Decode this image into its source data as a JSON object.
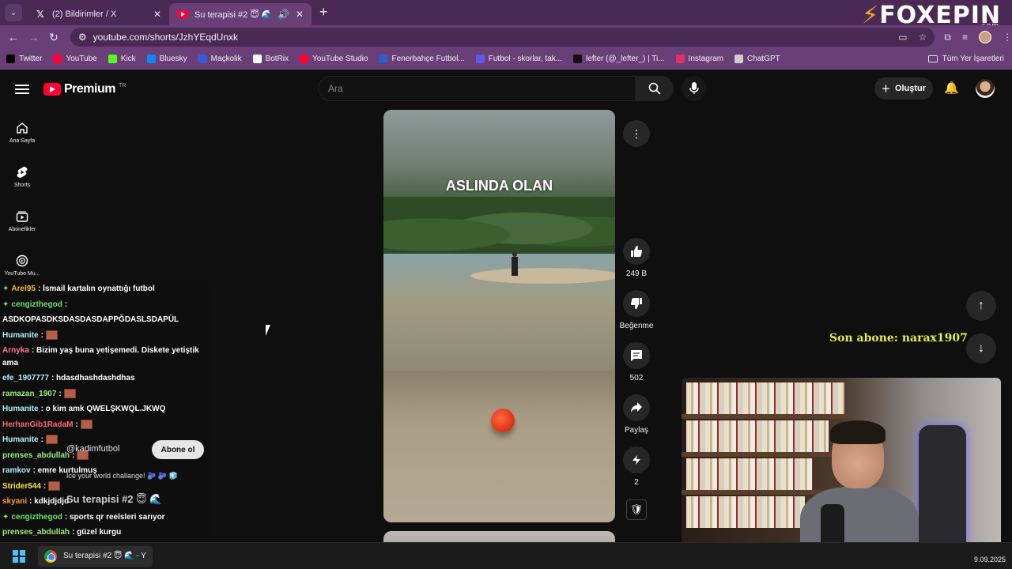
{
  "browser": {
    "tabs": [
      {
        "title": "(2) Bildirimler / X",
        "favicon": "x-logo"
      },
      {
        "title": "Su terapisi #2 😇 🌊 - YouT",
        "favicon": "youtube-logo"
      }
    ],
    "url": "youtube.com/shorts/JzhYEqdUnxk",
    "brand_overlay": "FOXEPIN",
    "brand_suffix": ".com",
    "bookmarks": [
      {
        "label": "Twitter",
        "color": "#000000"
      },
      {
        "label": "YouTube",
        "color": "#ff0033"
      },
      {
        "label": "Kick",
        "color": "#53fc18"
      },
      {
        "label": "Bluesky",
        "color": "#1185fe"
      },
      {
        "label": "Maçkolik",
        "color": "#3a5bd9"
      },
      {
        "label": "BotRix",
        "color": "#ffffff"
      },
      {
        "label": "YouTube Studio",
        "color": "#ff0033"
      },
      {
        "label": "Fenerbahçe Futbol...",
        "color": "#2b5cc9"
      },
      {
        "label": "Futbol - skorlar, tak...",
        "color": "#5a5af0"
      },
      {
        "label": "lefter (@_lefter_) | Ti...",
        "color": "#111111"
      },
      {
        "label": "Instagram",
        "color": "#e1306c"
      },
      {
        "label": "ChatGPT",
        "color": "#cccccc"
      }
    ],
    "all_bookmarks": "Tüm Yer İşaretleri"
  },
  "youtube": {
    "logo_text": "Premium",
    "logo_region": "TR",
    "search_placeholder": "Ara",
    "create_label": "Oluştur",
    "sidebar": [
      {
        "label": "Ana Sayfa",
        "icon": "home-icon"
      },
      {
        "label": "Shorts",
        "icon": "shorts-icon"
      },
      {
        "label": "Abonelikler",
        "icon": "subscriptions-icon"
      },
      {
        "label": "YouTube Mu...",
        "icon": "youtube-music-icon"
      }
    ],
    "short": {
      "caption": "ASLINDA OLAN",
      "channel": "@kadimfutbol",
      "subscribe": "Abone ol",
      "music": "Ice your world challange! 🫐 🫐 🧊",
      "title": "Su terapisi #2 😇 🌊"
    },
    "actions": {
      "likes": "249 B",
      "dislike": "Beğenme",
      "comments": "502",
      "share": "Paylaş",
      "remix": "2"
    }
  },
  "stream": {
    "sub_alert": "Son abone: narax1907",
    "chat": [
      {
        "user": "Arel95",
        "color": "#f5b942",
        "text": ": İsmail kartalın oynattığı futbol",
        "badge": true
      },
      {
        "user": "cengizthegod",
        "color": "#6ee16e",
        "text": ":",
        "badge": true,
        "wrap_text": "ASDKOPASDKSDASDASDAPPĞDASLSDAPÜL"
      },
      {
        "user": "Humanite",
        "color": "#b4f0ff",
        "text": ":",
        "emote": true
      },
      {
        "user": "Arnyka",
        "color": "#ff7a9a",
        "text": ": Bizim yaş buna yetişemedi. Diskete yetiştik ama",
        "wrap": true
      },
      {
        "user": "efe_1907777",
        "color": "#b4f0ff",
        "text": ": hdasdhashdashdhas"
      },
      {
        "user": "ramazan_1907",
        "color": "#9cf07a",
        "text": ":",
        "emote": true
      },
      {
        "user": "Humanite",
        "color": "#b4f0ff",
        "text": ": o kim amk QWELŞKWQL.JKWQ"
      },
      {
        "user": "HerhanGib1RadaM",
        "color": "#ff6b6b",
        "text": ":",
        "emote": true
      },
      {
        "user": "Humanite",
        "color": "#b4f0ff",
        "text": ":",
        "emote": true
      },
      {
        "user": "prenses_abdullah",
        "color": "#9cf07a",
        "text": ":",
        "emote": true
      },
      {
        "user": "ramkov",
        "color": "#b4f0ff",
        "text": ": emre kurtulmuş"
      },
      {
        "user": "Strider544",
        "color": "#f5e642",
        "text": ":",
        "emote": true
      },
      {
        "user": "skyani",
        "color": "#ff9a3d",
        "text": ": kdkjdjdjd"
      },
      {
        "user": "cengizthegod",
        "color": "#6ee16e",
        "text": ": sports qr reelsleri sarıyor",
        "badge": true
      },
      {
        "user": "prenses_abdullah",
        "color": "#9cf07a",
        "text": ": güzel kurgu"
      }
    ]
  },
  "taskbar": {
    "app_title": "Su terapisi #2 😇 🌊 - Y",
    "date": "9.09.2025"
  }
}
